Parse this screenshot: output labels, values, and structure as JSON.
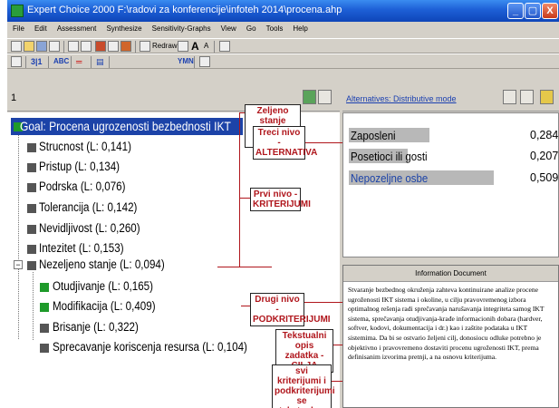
{
  "window": {
    "title": "Expert Choice 2000    F:\\radovi za konferencije\\infoteh 2014\\procena.ahp",
    "minimize": "_",
    "maximize": "▢",
    "close": "X"
  },
  "menu": [
    "File",
    "Edit",
    "Assessment",
    "Synthesize",
    "Sensitivity-Graphs",
    "View",
    "Go",
    "Tools",
    "Help"
  ],
  "toolbar": {
    "redraw_label": "Redraw",
    "font_big": "A",
    "font_small": "A",
    "level_label": "3|1",
    "abc_label": "ABC"
  },
  "tree": {
    "header_number": "1",
    "goal": "Goal: Procena ugrozenosti bezbednosti IKT",
    "criteria": [
      "Strucnost (L: 0,141)",
      "Pristup (L: 0,134)",
      "Podrska (L: 0,076)",
      "Tolerancija (L: 0,142)",
      "Nevidljivost (L: 0,260)",
      "Intezitet (L: 0,153)",
      "Nezeljeno stanje (L: 0,094)"
    ],
    "expander": "−",
    "subcriteria": [
      "Otudjivanje (L: 0,165)",
      "Modifikacija (L: 0,409)",
      "Brisanje (L: 0,322)",
      "Sprecavanje koriscenja resursa (L: 0,104)"
    ]
  },
  "annotations": {
    "goal_note": "Zeljeno stanje\nsistema - CILJ",
    "alt_note": "Treci nivo -\nALTERNATIVA",
    "criteria_note": "Prvi nivo -\nKRITERIJUMI",
    "subcriteria_note": "Drugi nivo -\nPODKRITERIJUMI",
    "text_note": "Tekstualni opis\nzadatka - CILJA",
    "all_note": "svi kriterijumi i\npodkriterijumi se\ntekstualno opisuju"
  },
  "alternatives": {
    "header": "Alternatives: Distributive mode",
    "items": [
      {
        "name": "Zaposleni",
        "value": "0,284",
        "fraction": 0.284
      },
      {
        "name": "Posetioci ili gosti",
        "value": "0,207",
        "fraction": 0.207
      },
      {
        "name": "Nepozeljne osbe",
        "value": "0,509",
        "fraction": 0.509
      }
    ]
  },
  "info": {
    "header": "Information Document",
    "text": "Stvaranje bezbednog okruženja zahteva kontinuirane analize procene ugroženosti IKT sistema i okoline, u cilju pravovremenog izbora optimalnog rešenja radi sprečavanja narušavanja integriteta samog IKT sistema, sprečavanja otudjivanja-krađe informacionih dobara (hardver, softver, kodovi, dokumentacija i dr.) kao i zaštite podataka u IKT sistemima.  Da bi se ostvario željeni cilj, donosiocu odluke potrebno je objektivno i pravovremeno dostaviti procenu ugroženosti IKT, prema definisanim izvorima pretnji, a na osnovu kriterijuma."
  },
  "colors": {
    "title_bar": "#1d5fd6",
    "goal_bg": "#1c43a8",
    "annotation": "#b0161c",
    "alt_highlight": "#1c43a8"
  }
}
